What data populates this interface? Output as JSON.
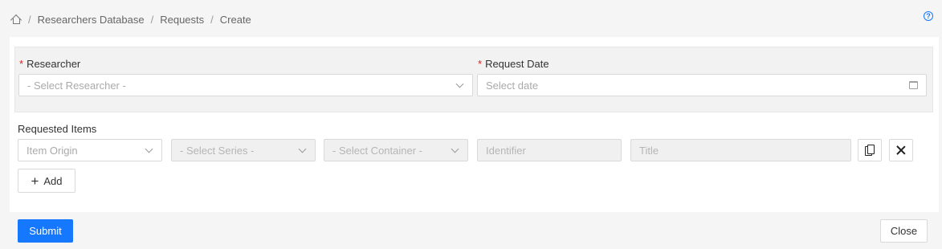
{
  "breadcrumb": {
    "items": [
      "Researchers Database",
      "Requests",
      "Create"
    ],
    "separator": "/"
  },
  "form": {
    "researcher": {
      "label": "Researcher",
      "required_mark": "*",
      "placeholder": "- Select Researcher -"
    },
    "request_date": {
      "label": "Request Date",
      "required_mark": "*",
      "placeholder": "Select date"
    },
    "requested_items": {
      "label": "Requested Items",
      "row": {
        "item_origin": "Item Origin",
        "series": "- Select Series -",
        "container": "- Select Container -",
        "identifier": "Identifier",
        "title": "Title"
      }
    },
    "add_label": "Add",
    "plus_glyph": "+"
  },
  "footer": {
    "submit_label": "Submit",
    "close_label": "Close"
  },
  "help_glyph": "?",
  "colors": {
    "primary": "#1677ff",
    "required": "#e02020"
  }
}
